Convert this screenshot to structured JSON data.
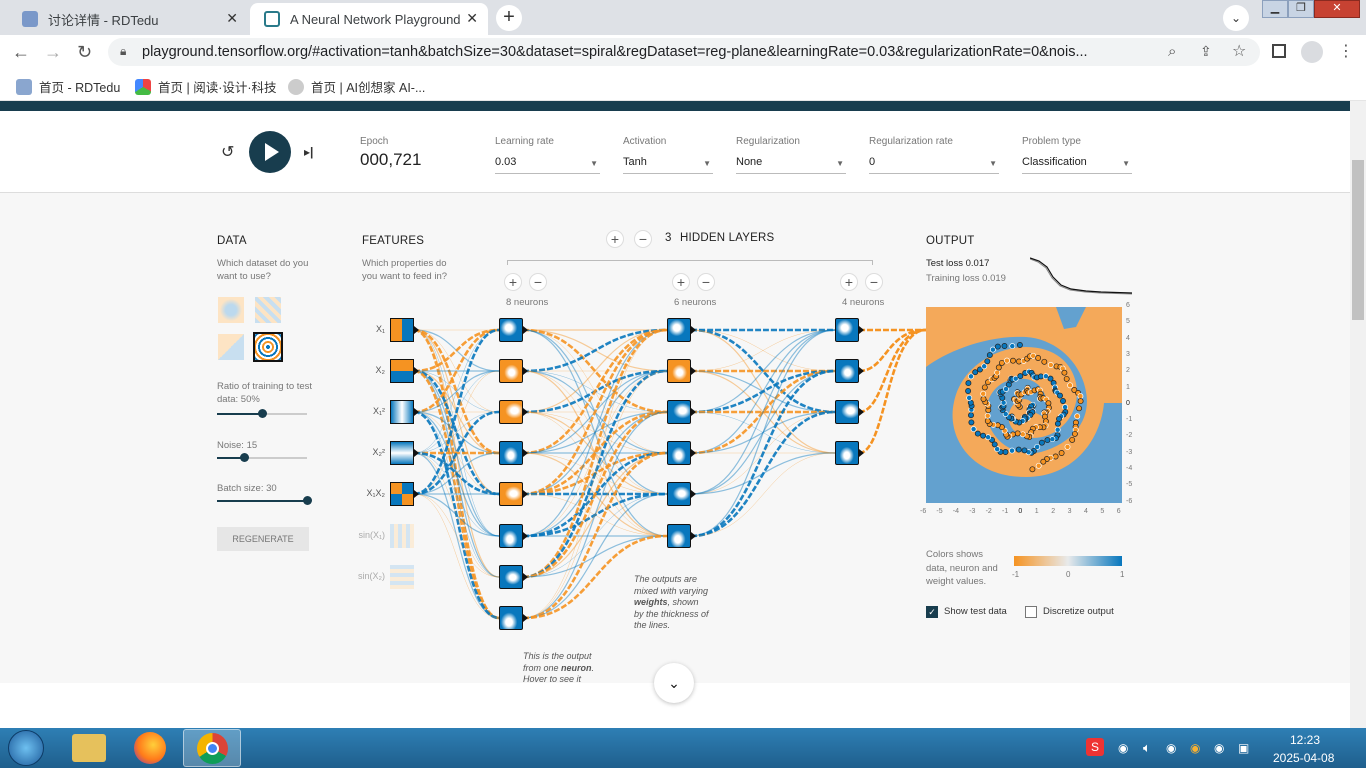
{
  "browser": {
    "tabs": [
      {
        "label": "讨论详情 - RDTedu",
        "active": false
      },
      {
        "label": "A Neural Network Playground",
        "active": true
      }
    ],
    "url": "playground.tensorflow.org/#activation=tanh&batchSize=30&dataset=spiral&regDataset=reg-plane&learningRate=0.03&regularizationRate=0&nois...",
    "bookmarks": [
      "首页 - RDTedu",
      "首页 | 阅读·设计·科技",
      "首页 | AI创想家 AI-..."
    ]
  },
  "controls": {
    "epoch_label": "Epoch",
    "epoch_value": "000,721",
    "learning_rate": {
      "label": "Learning rate",
      "value": "0.03"
    },
    "activation": {
      "label": "Activation",
      "value": "Tanh"
    },
    "regularization": {
      "label": "Regularization",
      "value": "None"
    },
    "regularization_rate": {
      "label": "Regularization rate",
      "value": "0"
    },
    "problem_type": {
      "label": "Problem type",
      "value": "Classification"
    }
  },
  "data_panel": {
    "title": "DATA",
    "question": "Which dataset do you want to use?",
    "ratio_label": "Ratio of training to test data:",
    "ratio_value": "50%",
    "ratio_fraction": 0.5,
    "noise_label": "Noise:",
    "noise_value": "15",
    "noise_fraction": 0.3,
    "batch_label": "Batch size:",
    "batch_value": "30",
    "batch_fraction": 1.0,
    "regenerate": "REGENERATE"
  },
  "features_panel": {
    "title": "FEATURES",
    "question": "Which properties do you want to feed in?",
    "features": [
      "X₁",
      "X₂",
      "X₁²",
      "X₂²",
      "X₁X₂",
      "sin(X₁)",
      "sin(X₂)"
    ]
  },
  "network": {
    "plus": "+",
    "minus": "−",
    "count": "3",
    "hidden_label": "HIDDEN LAYERS",
    "layers": [
      "8 neurons",
      "6 neurons",
      "4 neurons"
    ],
    "note_neuron_parts": [
      "This is the output from one ",
      "neuron",
      ". Hover to see it larger."
    ],
    "note_weights_parts": [
      "The outputs are mixed with varying ",
      "weights",
      ", shown by the thickness of the lines."
    ]
  },
  "output_panel": {
    "title": "OUTPUT",
    "test_loss_label": "Test loss",
    "test_loss": "0.017",
    "training_loss_label": "Training loss",
    "training_loss": "0.019",
    "axis_ticks": [
      "-6",
      "-5",
      "-4",
      "-3",
      "-2",
      "-1",
      "0",
      "1",
      "2",
      "3",
      "4",
      "5",
      "6"
    ],
    "y_axis_ticks": [
      "6",
      "5",
      "4",
      "3",
      "2",
      "1",
      "0",
      "-1",
      "-2",
      "-3",
      "-4",
      "-5",
      "-6"
    ],
    "legend_note": "Colors shows data, neuron and weight values.",
    "legend_ticks": [
      "-1",
      "0",
      "1"
    ],
    "show_test_label": "Show test data",
    "show_test_checked": true,
    "discretize_label": "Discretize output",
    "discretize_checked": false
  },
  "colors": {
    "orange": "#f59322",
    "blue": "#0877bd",
    "dark": "#183d4e"
  },
  "taskbar": {
    "time": "12:23",
    "date": "2025-04-08"
  }
}
